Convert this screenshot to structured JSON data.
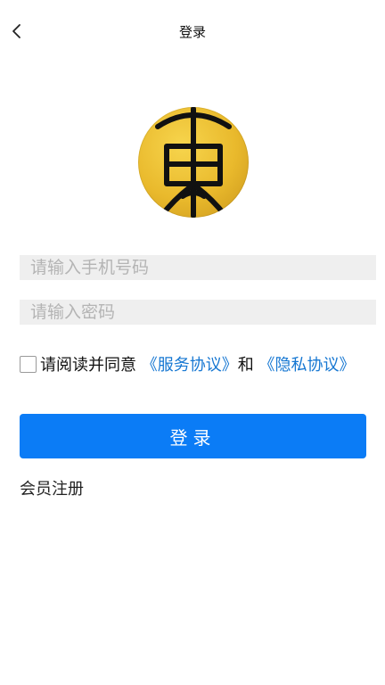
{
  "header": {
    "title": "登录",
    "back_icon": "chevron-left-icon"
  },
  "logo": {
    "icon": "seal-logo-icon",
    "background": "#e9b92c"
  },
  "form": {
    "phone_placeholder": "请输入手机号码",
    "password_placeholder": "请输入密码"
  },
  "agreement": {
    "checked": false,
    "prefix": "请阅读并同意 ",
    "service_link": "《服务协议》",
    "middle": "和 ",
    "privacy_link": "《隐私协议》"
  },
  "login_button": {
    "label": "登录",
    "color": "#0b7cf6"
  },
  "register_link": "会员注册",
  "colors": {
    "link": "#1677d2",
    "input_bg": "#efefef"
  }
}
